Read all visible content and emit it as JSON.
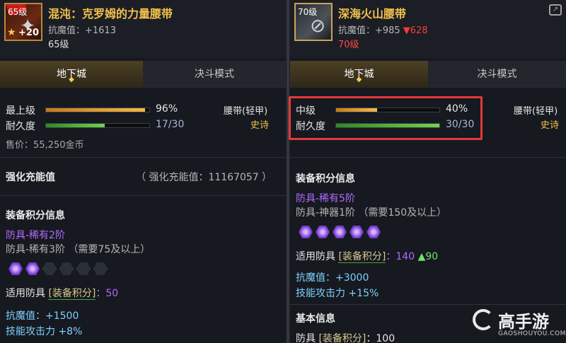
{
  "left": {
    "icon": {
      "level": "65级",
      "plus": "+20",
      "name": "item-belt-icon"
    },
    "name": "混沌：克罗姆的力量腰带",
    "stat_label": "抗魔值：+1613",
    "level_req": "65级",
    "tabs": [
      {
        "label": "地下城",
        "active": true
      },
      {
        "label": "决斗模式",
        "active": false
      }
    ],
    "grade_label": "最上级",
    "grade_value": "96%",
    "grade_fraction": 0.96,
    "durability_label": "耐久度",
    "durability_value": "17/30",
    "durability_fraction": 0.567,
    "type": "腰带(轻甲)",
    "rarity": "史诗",
    "price": "售价：55,250金币",
    "enhance_label": "强化充能值",
    "enhance_value": "（ 强化充能值：11167057 ）",
    "score_title": "装备积分信息",
    "score_tier": "防具-稀有2阶",
    "score_next": "防具-稀有3阶 （需要75及以上）",
    "gems_on": 2,
    "gems_total": 6,
    "apply_prefix": "适用防具",
    "apply_tag": "[装备积分]",
    "apply_value": "：50",
    "bonus1": "抗魔值：+1500",
    "bonus2": "技能攻击力 +8%"
  },
  "right": {
    "icon": {
      "level": "70级",
      "name": "item-belt-icon"
    },
    "name": "深海火山腰带",
    "stat_label": "抗魔值：+985",
    "stat_down": "▼628",
    "level_req": "70级",
    "tabs": [
      {
        "label": "地下城",
        "active": true
      },
      {
        "label": "决斗模式",
        "active": false
      }
    ],
    "grade_label": "中级",
    "grade_value": "40%",
    "grade_fraction": 0.4,
    "durability_label": "耐久度",
    "durability_value": "30/30",
    "durability_fraction": 1.0,
    "type": "腰带(轻甲)",
    "rarity": "史诗",
    "score_title": "装备积分信息",
    "score_tier": "防具-稀有5阶",
    "score_next": "防具-神器1阶 （需要150及以上）",
    "gems_on": 5,
    "gems_total": 5,
    "apply_prefix": "适用防具",
    "apply_tag": "[装备积分]",
    "apply_value": "：140",
    "apply_up": "▲90",
    "bonus1": "抗魔值：+3000",
    "bonus2": "技能攻击力 +15%",
    "basic_title": "基本信息",
    "basic_prefix": "防具",
    "basic_tag": "[装备积分]",
    "basic_value": "：100"
  },
  "watermark": {
    "text": "高手游",
    "sub": "GAOSHOUYOU.COM"
  },
  "colors": {
    "accent": "#f2c14e",
    "highlight": "#e23a3a",
    "purple": "#b36bff",
    "green": "#77e06a"
  }
}
